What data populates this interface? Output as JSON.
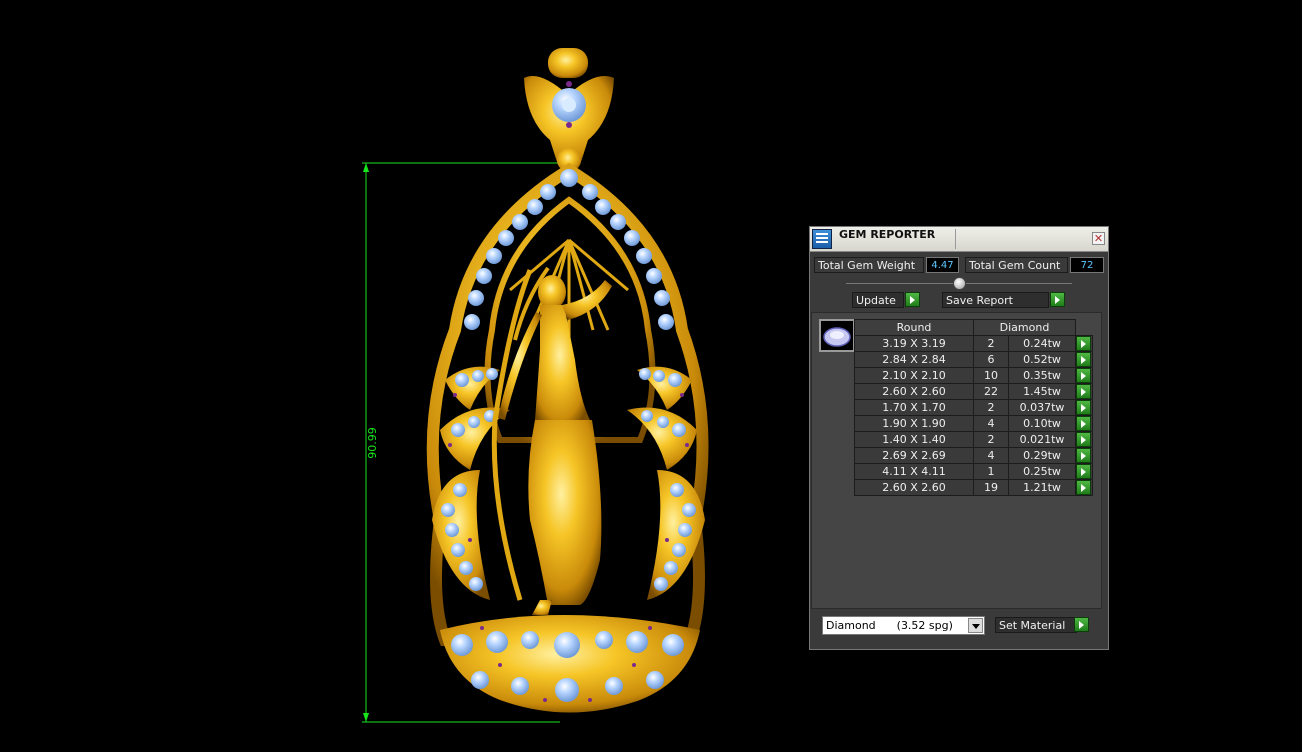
{
  "viewport": {
    "dimension_label": "90.99",
    "colors": {
      "gold": "#f2b81c",
      "gem": "#9ec4f5",
      "accent_gem": "#7a2a8a",
      "dimension": "#17e61c"
    }
  },
  "gem_reporter": {
    "title": "GEM REPORTER",
    "close_symbol": "✕",
    "total_gem_weight_label": "Total Gem Weight",
    "total_gem_weight_value": "4.47",
    "total_gem_count_label": "Total Gem Count",
    "total_gem_count_value": "72",
    "update_label": "Update",
    "save_report_label": "Save Report",
    "table": {
      "headers": [
        "Round",
        "Diamond"
      ],
      "rows": [
        {
          "size": "3.19 X 3.19",
          "count": "2",
          "weight": "0.24tw"
        },
        {
          "size": "2.84 X 2.84",
          "count": "6",
          "weight": "0.52tw"
        },
        {
          "size": "2.10 X 2.10",
          "count": "10",
          "weight": "0.35tw"
        },
        {
          "size": "2.60 X 2.60",
          "count": "22",
          "weight": "1.45tw"
        },
        {
          "size": "1.70 X 1.70",
          "count": "2",
          "weight": "0.037tw"
        },
        {
          "size": "1.90 X 1.90",
          "count": "4",
          "weight": "0.10tw"
        },
        {
          "size": "1.40 X 1.40",
          "count": "2",
          "weight": "0.021tw"
        },
        {
          "size": "2.69 X 2.69",
          "count": "4",
          "weight": "0.29tw"
        },
        {
          "size": "4.11 X 4.11",
          "count": "1",
          "weight": "0.25tw"
        },
        {
          "size": "2.60 X 2.60",
          "count": "19",
          "weight": "1.21tw"
        }
      ]
    },
    "material_select_value": "Diamond      (3.52 spg)",
    "set_material_label": "Set Material"
  }
}
